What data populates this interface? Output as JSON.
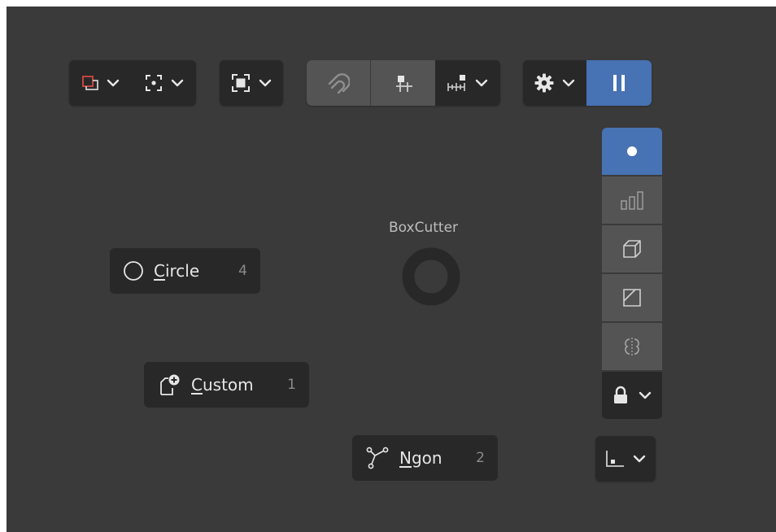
{
  "header_toolbar": {
    "groups": [
      {
        "name": "mode",
        "items": [
          "mode-box-red-icon",
          "chevron-down-icon",
          "pivot-icon",
          "chevron-down-icon"
        ]
      },
      {
        "name": "select",
        "items": [
          "select-box-icon",
          "chevron-down-icon"
        ]
      },
      {
        "name": "snap",
        "items": [
          "snap-magnet-icon",
          "grid-snap-icon",
          "increment-icon",
          "chevron-down-icon"
        ]
      },
      {
        "name": "settings",
        "items": [
          "gear-icon",
          "chevron-down-icon",
          "pause-icon"
        ]
      }
    ],
    "active_color": "#4772b3"
  },
  "side_stack": {
    "items": [
      "dot-icon",
      "bars-icon",
      "box-icon",
      "slice-icon",
      "mirror-icon",
      "lock-icon"
    ],
    "active_index": 0
  },
  "extra_button": {
    "icon": "origin-icon"
  },
  "pie_menu": {
    "title": "BoxCutter",
    "items": [
      {
        "prefix": "",
        "mnemonic": "C",
        "rest": "ircle",
        "hotkey": "4",
        "icon": "circle-icon"
      },
      {
        "prefix": "",
        "mnemonic": "C",
        "rest": "ustom",
        "hotkey": "1",
        "icon": "custom-shape-icon"
      },
      {
        "prefix": "",
        "mnemonic": "N",
        "rest": "gon",
        "hotkey": "2",
        "icon": "ngon-icon"
      }
    ]
  }
}
